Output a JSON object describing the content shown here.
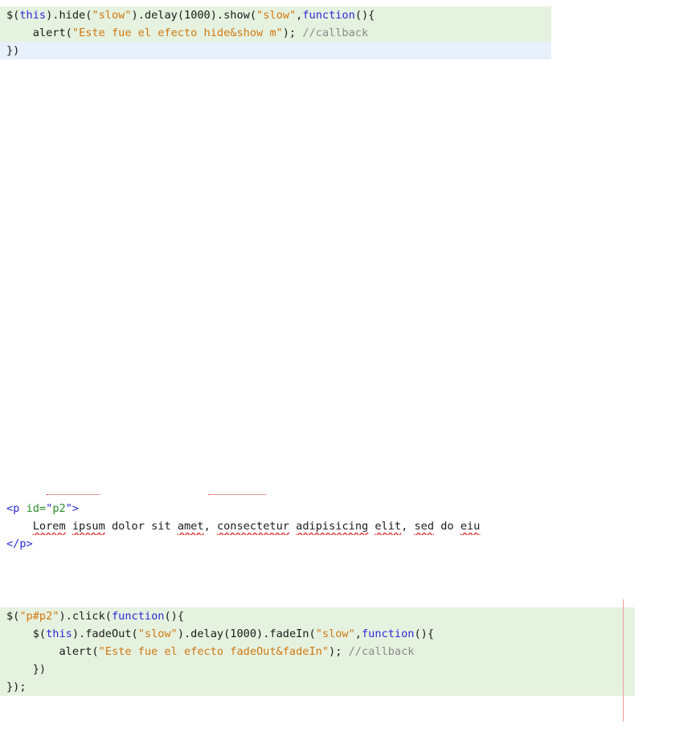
{
  "block1": {
    "lines": [
      [
        {
          "t": "$(",
          "c": "default"
        },
        {
          "t": "this",
          "c": "kw"
        },
        {
          "t": ").hide(",
          "c": "default"
        },
        {
          "t": "\"slow\"",
          "c": "str"
        },
        {
          "t": ").delay(1000).show(",
          "c": "default"
        },
        {
          "t": "\"slow\"",
          "c": "str"
        },
        {
          "t": ",",
          "c": "default"
        },
        {
          "t": "function",
          "c": "kw"
        },
        {
          "t": "(){",
          "c": "default"
        }
      ],
      [
        {
          "t": "    alert(",
          "c": "default"
        },
        {
          "t": "\"Este fue el efecto hide&show m\"",
          "c": "str"
        },
        {
          "t": "); ",
          "c": "default"
        },
        {
          "t": "//callback",
          "c": "com"
        }
      ],
      [
        {
          "t": "})",
          "c": "default"
        }
      ]
    ]
  },
  "block2": {
    "lines": [
      [
        {
          "t": "<p ",
          "c": "tag"
        },
        {
          "t": "id=",
          "c": "attr"
        },
        {
          "t": "\"",
          "c": "tag"
        },
        {
          "t": "p2",
          "c": "attr"
        },
        {
          "t": "\">",
          "c": "tag"
        }
      ],
      [
        {
          "t": "    ",
          "c": "default"
        },
        {
          "t": "Lorem",
          "c": "default",
          "spell": true
        },
        {
          "t": " ",
          "c": "default"
        },
        {
          "t": "ipsum",
          "c": "default",
          "spell": true
        },
        {
          "t": " dolor sit ",
          "c": "default"
        },
        {
          "t": "amet",
          "c": "default",
          "spell": true
        },
        {
          "t": ", ",
          "c": "default"
        },
        {
          "t": "consectetur",
          "c": "default",
          "spell": true
        },
        {
          "t": " ",
          "c": "default"
        },
        {
          "t": "adipisicing",
          "c": "default",
          "spell": true
        },
        {
          "t": " ",
          "c": "default"
        },
        {
          "t": "elit",
          "c": "default",
          "spell": true
        },
        {
          "t": ", ",
          "c": "default"
        },
        {
          "t": "sed",
          "c": "default",
          "spell": true
        },
        {
          "t": " do ",
          "c": "default"
        },
        {
          "t": "eiu",
          "c": "default",
          "spell": true
        }
      ],
      [
        {
          "t": "</p>",
          "c": "tag"
        }
      ]
    ]
  },
  "block3": {
    "lines": [
      [
        {
          "t": "$(",
          "c": "default"
        },
        {
          "t": "\"p#p2\"",
          "c": "str"
        },
        {
          "t": ").click(",
          "c": "default"
        },
        {
          "t": "function",
          "c": "kw"
        },
        {
          "t": "(){",
          "c": "default"
        }
      ],
      [
        {
          "t": "    $(",
          "c": "default"
        },
        {
          "t": "this",
          "c": "kw"
        },
        {
          "t": ").fadeOut(",
          "c": "default"
        },
        {
          "t": "\"slow\"",
          "c": "str"
        },
        {
          "t": ").delay(1000).fadeIn(",
          "c": "default"
        },
        {
          "t": "\"slow\"",
          "c": "str"
        },
        {
          "t": ",",
          "c": "default"
        },
        {
          "t": "function",
          "c": "kw"
        },
        {
          "t": "(){",
          "c": "default"
        }
      ],
      [
        {
          "t": "        alert(",
          "c": "default"
        },
        {
          "t": "\"Este fue el efecto fadeOut&fadeIn\"",
          "c": "str"
        },
        {
          "t": "); ",
          "c": "default"
        },
        {
          "t": "//callback",
          "c": "com"
        }
      ],
      [
        {
          "t": "    })",
          "c": "default"
        }
      ],
      [
        {
          "t": "});",
          "c": "default"
        }
      ]
    ]
  }
}
